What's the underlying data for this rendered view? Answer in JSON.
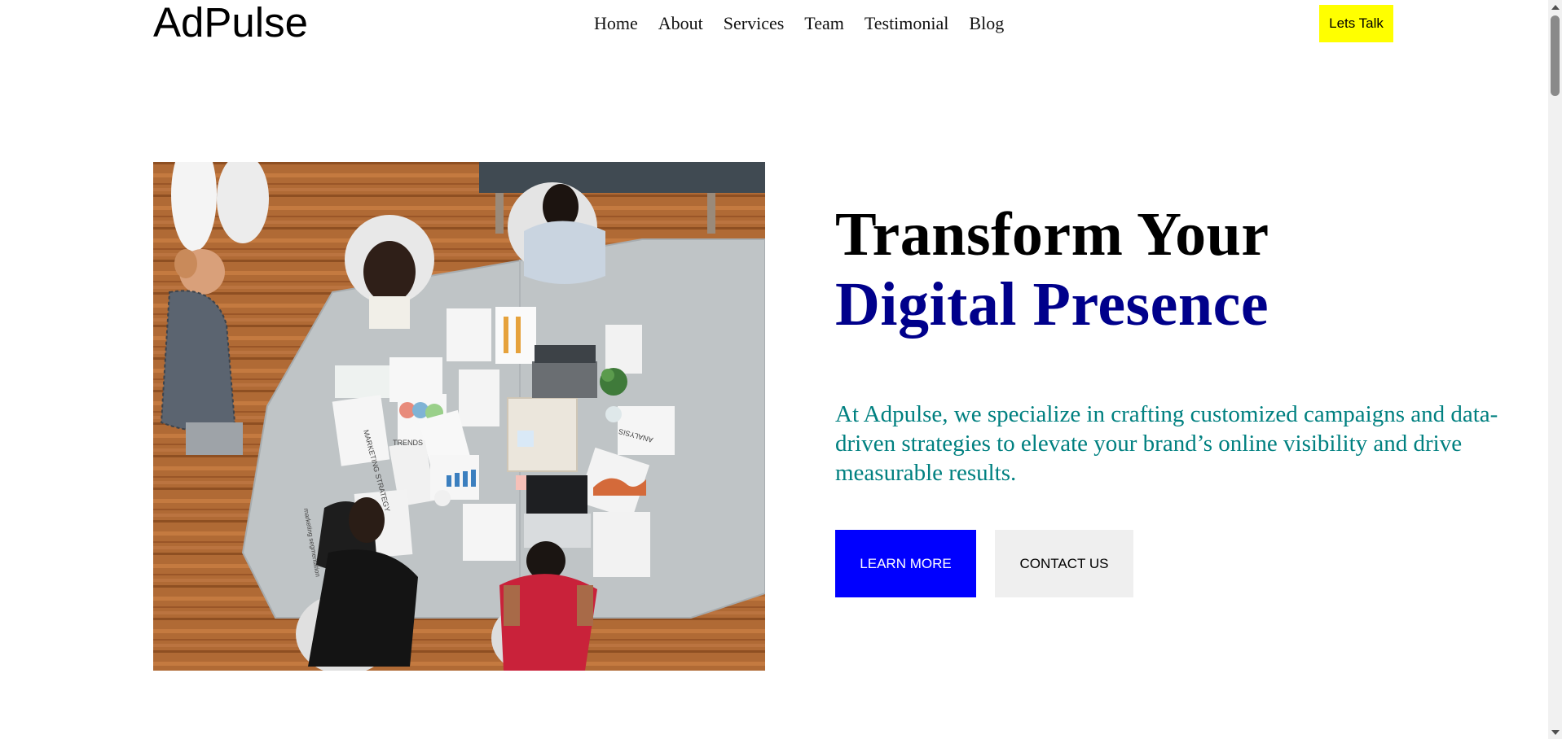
{
  "header": {
    "logo": "AdPulse",
    "nav": [
      "Home",
      "About",
      "Services",
      "Team",
      "Testimonial",
      "Blog"
    ],
    "cta_label": "Lets Talk"
  },
  "hero": {
    "headline_line1": "Transform Your",
    "headline_line2": "Digital Presence",
    "description": "At Adpulse, we specialize in crafting customized campaigns and data-driven strategies to elevate your brand’s online visibility and drive measurable results.",
    "learn_more_label": "LEARN MORE",
    "contact_label": "CONTACT US",
    "image_alt": "Team meeting around a table viewed from above",
    "image_text": {
      "marketing_strategy": "MARKETING STRATEGY",
      "trends": "TRENDS",
      "analysis": "ANALYSIS",
      "marketing_segmentation": "marketing segmentation"
    }
  },
  "colors": {
    "headline_accent": "#00008b",
    "description": "#008080",
    "learn_more_bg": "#0000ff",
    "contact_bg": "#efefef",
    "lets_talk_bg": "#ffff00"
  }
}
